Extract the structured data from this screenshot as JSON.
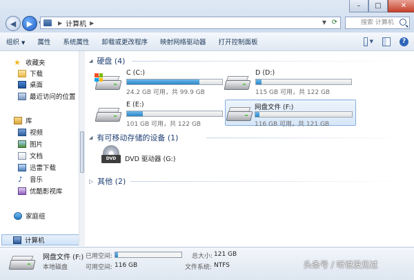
{
  "address": {
    "segments": [
      "计算机"
    ],
    "search_placeholder": "搜索 计算机"
  },
  "window_controls": {
    "minimize": "–",
    "maximize": "□",
    "close": "✕"
  },
  "toolbar": {
    "items": [
      "组织",
      "属性",
      "系统属性",
      "卸载或更改程序",
      "映射网络驱动器",
      "打开控制面板"
    ],
    "help": "?"
  },
  "nav": {
    "favorites": "收藏夹",
    "downloads": "下载",
    "desktop": "桌面",
    "recent": "最近访问的位置",
    "libraries": "库",
    "videos": "视频",
    "pictures": "图片",
    "documents": "文档",
    "thunder": "迅雷下载",
    "music": "音乐",
    "youku": "优酷影视库",
    "homegroup": "家庭组",
    "computer": "计算机"
  },
  "groups": {
    "hard_disks": "硬盘 (4)",
    "removable": "有可移动存储的设备 (1)",
    "other": "其他 (2)"
  },
  "drives": [
    {
      "name": "C (C:)",
      "info": "24.2 GB 可用，共 99.9 GB",
      "used_fraction": 0.76
    },
    {
      "name": "D (D:)",
      "info": "115 GB 可用，共 122 GB",
      "used_fraction": 0.06
    },
    {
      "name": "E (E:)",
      "info": "101 GB 可用，共 122 GB",
      "used_fraction": 0.17
    },
    {
      "name": "网盘文件 (F:)",
      "info": "116 GB 可用，共 121 GB",
      "used_fraction": 0.04
    }
  ],
  "dvd": {
    "name": "DVD 驱动器 (G:)",
    "badge": "DVD"
  },
  "details": {
    "name": "网盘文件 (F:)",
    "type": "本地磁盘",
    "used_label": "已用空间:",
    "free_label": "可用空间:",
    "free_value": "116 GB",
    "total_label": "总大小:",
    "total_value": "121 GB",
    "fs_label": "文件系统:",
    "fs_value": "NTFS",
    "used_fraction": 0.04
  },
  "watermark": "头条号 / 听说没见过"
}
